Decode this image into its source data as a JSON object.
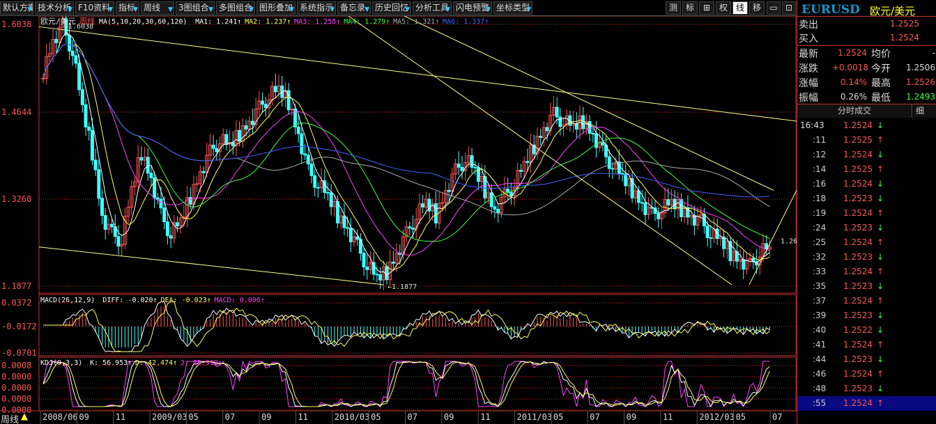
{
  "toolbar": {
    "buttons": [
      "默认方案",
      "技术分析",
      "F10资料",
      "指标",
      "周线",
      "3图组合",
      "多图组合",
      "图形叠加",
      "系统指示",
      "备忘录",
      "历史回忆",
      "分析工具",
      "闪电预警",
      "坐标类型"
    ],
    "right_buttons": [
      "测",
      "标",
      "⊞",
      "权",
      "线",
      "移"
    ],
    "active_right": "线"
  },
  "chart_header": {
    "title": "欧元/美元",
    "period": "周线",
    "ma_legend": [
      {
        "label": "MA(5,10,20,30,60,120)",
        "color": "#ffffff"
      },
      {
        "label": "MA1: 1.241",
        "color": "#ffffff"
      },
      {
        "label": "MA2: 1.237",
        "color": "#ffff60"
      },
      {
        "label": "MA3: 1.258",
        "color": "#ff40ff"
      },
      {
        "label": "MA4: 1.279",
        "color": "#40ff40"
      },
      {
        "label": "MA5: 1.321",
        "color": "#aaaaaa"
      },
      {
        "label": "MA6: 1.337",
        "color": "#4060ff"
      }
    ],
    "macd_legend": [
      {
        "label": "MACD(26,12,9)",
        "color": "#ffffff"
      },
      {
        "label": "DIFF: -0.020",
        "color": "#ffffff"
      },
      {
        "label": "DEA: -0.023",
        "color": "#ffff60"
      },
      {
        "label": "MACD: 0.006",
        "color": "#ff40ff"
      }
    ],
    "kdj_legend": [
      {
        "label": "KDJ(9,3,3)",
        "color": "#ffffff"
      },
      {
        "label": "K: 56.953",
        "color": "#ffffff"
      },
      {
        "label": "D: 42.474",
        "color": "#ffff60"
      },
      {
        "label": "J: 85.910",
        "color": "#ff40ff"
      }
    ]
  },
  "chart_data": {
    "type": "candlestick",
    "price_axis_ticks": [
      "1.6038",
      "1.4644",
      "1.3260",
      "1.1877"
    ],
    "price_range": [
      1.1877,
      1.6038
    ],
    "macd_axis_ticks": [
      "0.0372",
      "-0.0172",
      "-0.0701"
    ],
    "kdj_axis_ticks": [
      "0.0008",
      "0.0000",
      "0.0000",
      "0.0000",
      "0.0000"
    ],
    "time_labels": [
      "2008/06",
      "09",
      "11",
      "2009/03",
      "05",
      "07",
      "09",
      "11",
      "2010/03",
      "05",
      "07",
      "09",
      "11",
      "2011/03",
      "05",
      "07",
      "09",
      "11",
      "2012/03",
      "05",
      "07"
    ],
    "annotations": [
      "1.6038",
      "1.1877",
      "1.26"
    ],
    "close_series": [
      1.53,
      1.58,
      1.6,
      1.56,
      1.47,
      1.4,
      1.3,
      1.27,
      1.26,
      1.34,
      1.4,
      1.36,
      1.3,
      1.27,
      1.29,
      1.33,
      1.37,
      1.4,
      1.42,
      1.41,
      1.43,
      1.45,
      1.47,
      1.49,
      1.5,
      1.48,
      1.43,
      1.37,
      1.35,
      1.33,
      1.3,
      1.28,
      1.25,
      1.22,
      1.2,
      1.21,
      1.24,
      1.27,
      1.3,
      1.32,
      1.3,
      1.34,
      1.37,
      1.39,
      1.37,
      1.34,
      1.31,
      1.33,
      1.35,
      1.38,
      1.41,
      1.44,
      1.46,
      1.45,
      1.44,
      1.45,
      1.43,
      1.4,
      1.38,
      1.36,
      1.34,
      1.32,
      1.3,
      1.31,
      1.32,
      1.31,
      1.3,
      1.29,
      1.27,
      1.26,
      1.24,
      1.23,
      1.22,
      1.24,
      1.25
    ]
  },
  "quote_panel": {
    "symbol": "EURUSD",
    "name": "欧元/美元",
    "sell_label": "卖出",
    "sell_value": "1.2525",
    "buy_label": "买入",
    "buy_value": "1.2524",
    "rows": [
      {
        "l1": "最新",
        "v1": "1.2524",
        "c1": "#ff5555",
        "l2": "均价",
        "v2": "-",
        "c2": "#dddddd"
      },
      {
        "l1": "涨跌",
        "v1": "+0.0018",
        "c1": "#ff5555",
        "l2": "今开",
        "v2": "1.2506",
        "c2": "#dddddd"
      },
      {
        "l1": "涨幅",
        "v1": "0.14%",
        "c1": "#ff5555",
        "l2": "最高",
        "v2": "1.2526",
        "c2": "#ff5555"
      },
      {
        "l1": "振幅",
        "v1": "0.26%",
        "c1": "#dddddd",
        "l2": "最低",
        "v2": "1.2493",
        "c2": "#40ff40"
      }
    ],
    "tab_label": "分时成交",
    "tab2_label": "细",
    "ticks": [
      {
        "t": "16:43",
        "p": "1.2524",
        "d": "down"
      },
      {
        "t": ":11",
        "p": "1.2525",
        "d": "up"
      },
      {
        "t": ":12",
        "p": "1.2524",
        "d": "down"
      },
      {
        "t": ":14",
        "p": "1.2525",
        "d": "up"
      },
      {
        "t": ":16",
        "p": "1.2524",
        "d": "down"
      },
      {
        "t": ":18",
        "p": "1.2523",
        "d": "down"
      },
      {
        "t": ":19",
        "p": "1.2524",
        "d": "up"
      },
      {
        "t": ":24",
        "p": "1.2523",
        "d": "down"
      },
      {
        "t": ":25",
        "p": "1.2524",
        "d": "up"
      },
      {
        "t": ":32",
        "p": "1.2523",
        "d": "down"
      },
      {
        "t": ":33",
        "p": "1.2524",
        "d": "up"
      },
      {
        "t": ":35",
        "p": "1.2523",
        "d": "down"
      },
      {
        "t": ":37",
        "p": "1.2524",
        "d": "up"
      },
      {
        "t": ":39",
        "p": "1.2523",
        "d": "down"
      },
      {
        "t": ":40",
        "p": "1.2522",
        "d": "down"
      },
      {
        "t": ":41",
        "p": "1.2524",
        "d": "up"
      },
      {
        "t": ":44",
        "p": "1.2523",
        "d": "down"
      },
      {
        "t": ":46",
        "p": "1.2524",
        "d": "up"
      },
      {
        "t": ":48",
        "p": "1.2523",
        "d": "down"
      },
      {
        "t": ":55",
        "p": "1.2524",
        "d": "up"
      }
    ]
  },
  "status": {
    "period_label": "周线"
  },
  "colors": {
    "up": "#ff5555",
    "down": "#40ffff",
    "grid": "#a01010",
    "axis": "#c03030"
  }
}
